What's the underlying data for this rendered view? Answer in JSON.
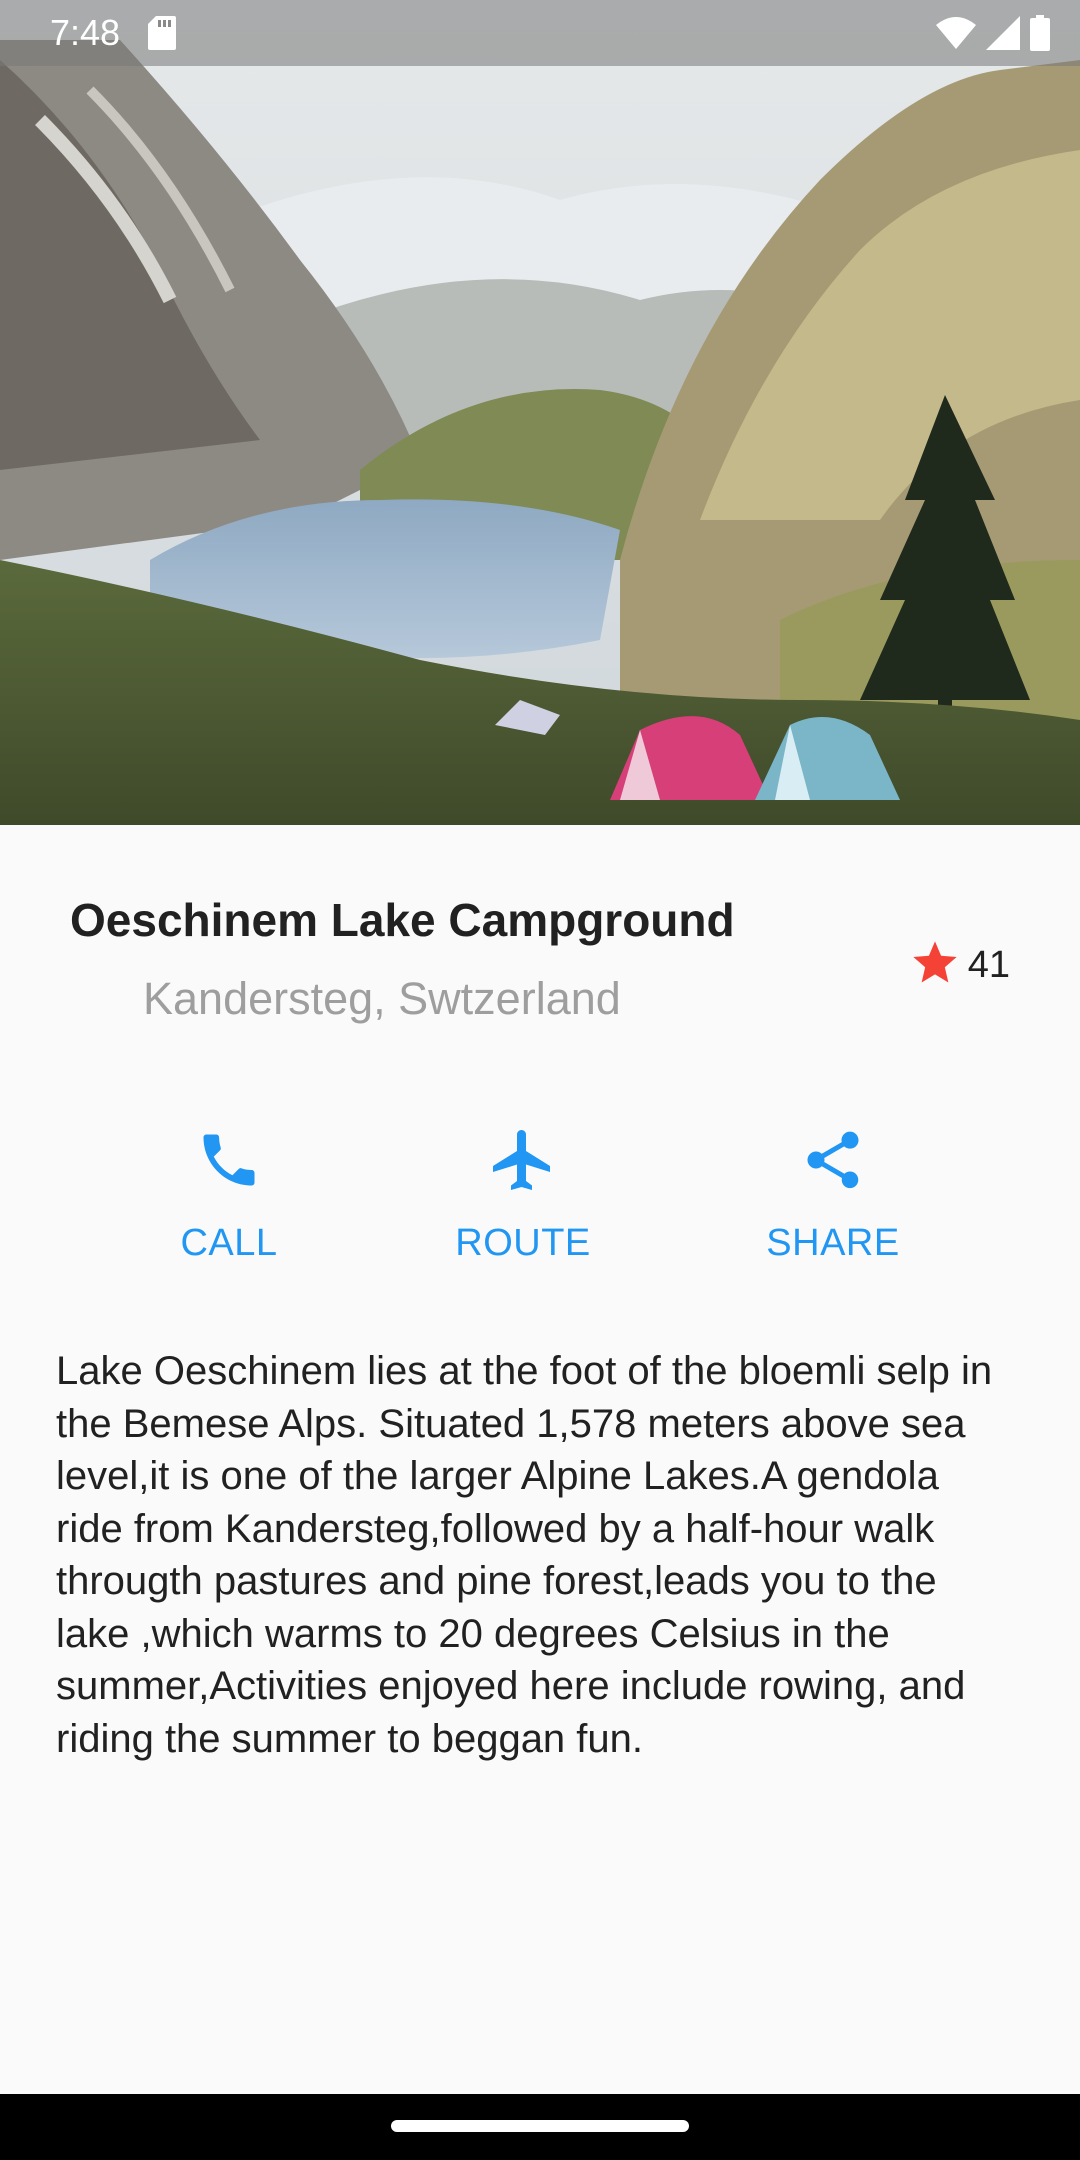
{
  "status_bar": {
    "time": "7:48",
    "icons": [
      "sd-card-icon",
      "wifi-icon",
      "signal-icon",
      "battery-icon"
    ]
  },
  "hero": {
    "image": "mountain-lake-campground-photo"
  },
  "place": {
    "title": "Oeschinem Lake Campground",
    "subtitle": "Kandersteg, Swtzerland",
    "rating_count": "41",
    "rating_icon": "star-icon"
  },
  "actions": [
    {
      "label": "CALL",
      "icon": "phone-icon"
    },
    {
      "label": "ROUTE",
      "icon": "airplane-icon"
    },
    {
      "label": "SHARE",
      "icon": "share-icon"
    }
  ],
  "description": "Lake Oeschinem lies at the foot of the bloemli selp in the Bemese Alps. Situated 1,578 meters above sea level,it is one of the larger Alpine Lakes.A gendola ride from Kandersteg,followed by a half-hour walk througth pastures and pine forest,leads you to the lake ,which warms to 20 degrees Celsius in the summer,Activities enjoyed here include rowing, and riding the summer to beggan fun.",
  "colors": {
    "accent": "#2196f3",
    "star": "#f44336",
    "title": "#212121",
    "subtitle": "#9e9e9e",
    "background": "#fafafa"
  }
}
